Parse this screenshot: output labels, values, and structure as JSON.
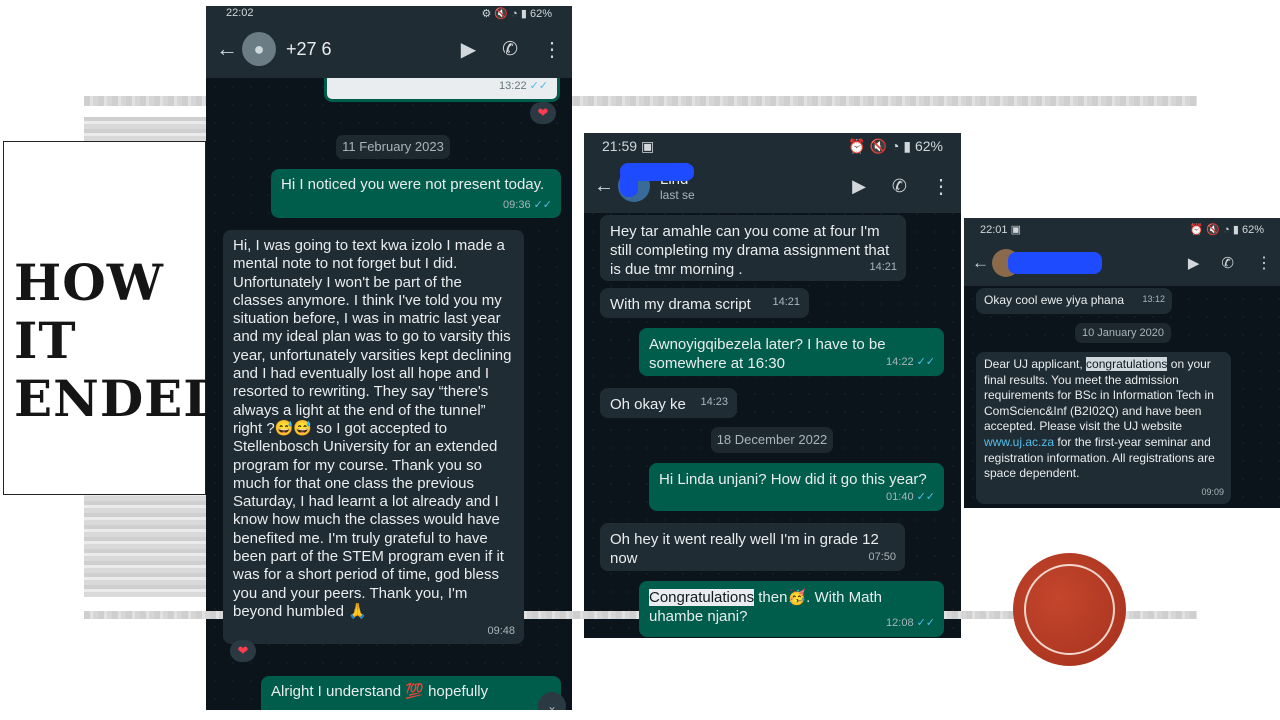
{
  "slide": {
    "title": "HOW IT ENDED",
    "accent": "#b03a22"
  },
  "shot1": {
    "status_time": "22:02",
    "status_battery": "62%",
    "contact": "+27 6",
    "top_bubble_time": "13:22",
    "date_pill": "11 February 2023",
    "messages": [
      {
        "dir": "out",
        "text": "Hi I noticed you were not present today.",
        "time": "09:36"
      },
      {
        "dir": "in",
        "text": "Hi, I was going to text kwa izolo I made a mental note to not forget but I did. Unfortunately I won't be part of the classes anymore. I think I've told you my situation before, I was in matric last year and my ideal plan was to go to varsity this year, unfortunately varsities kept declining and I had eventually lost all hope and I resorted to rewriting. They say “there's always a light at the end of the tunnel” right ?😅😅 so I got accepted to Stellenbosch University for an extended program for my course. Thank you so much for that one class the previous Saturday, I had learnt a lot already and I know how much the classes would have benefited me. I'm truly grateful to have been part of the STEM program even if it was for a short period of time, god bless you and your peers. Thank you, I'm beyond humbled 🙏",
        "time": "09:48"
      },
      {
        "dir": "out",
        "text": "Alright I understand 💯 hopefully"
      }
    ],
    "reaction": "❤"
  },
  "shot2": {
    "status_time": "21:59",
    "status_battery": "62%",
    "contact_name": "Lind",
    "contact_sub": "last se",
    "date_pill": "18 December 2022",
    "messages": [
      {
        "dir": "in",
        "text": "Hey tar amahle can you come at four I'm still completing my drama assignment that is due tmr morning .",
        "time": "14:21"
      },
      {
        "dir": "in",
        "text": "With my drama script",
        "time": "14:21"
      },
      {
        "dir": "out",
        "text": "Awnoyigqibezela later? I have to be somewhere at 16:30",
        "time": "14:22"
      },
      {
        "dir": "in",
        "text": "Oh okay ke",
        "time": "14:23"
      },
      {
        "dir": "out",
        "text": "Hi Linda unjani? How did it go this year?",
        "time": "01:40"
      },
      {
        "dir": "in",
        "text": "Oh hey it went really well I'm in grade 12 now",
        "time": "07:50"
      },
      {
        "dir": "out",
        "highlight": "Congratulations",
        "text": " then🥳. With Math uhambe njani?",
        "time": "12:08"
      }
    ]
  },
  "shot3": {
    "status_time": "22:01",
    "status_battery": "62%",
    "date_pill": "10 January 2020",
    "messages": [
      {
        "dir": "in",
        "text": "Okay cool ewe yiya phana",
        "time": "13:12"
      },
      {
        "dir": "in",
        "pre": "Dear UJ applicant, ",
        "highlight": "congratulations",
        "text": " on your final results. You meet the admission requirements for BSc in Information Tech in ComScienc&Inf (B2I02Q) and have been accepted.  Please visit the UJ website ",
        "link": "www.uj.ac.za",
        "post": " for the first-year seminar and registration information. All registrations are space dependent.",
        "time": "09:09"
      }
    ]
  }
}
